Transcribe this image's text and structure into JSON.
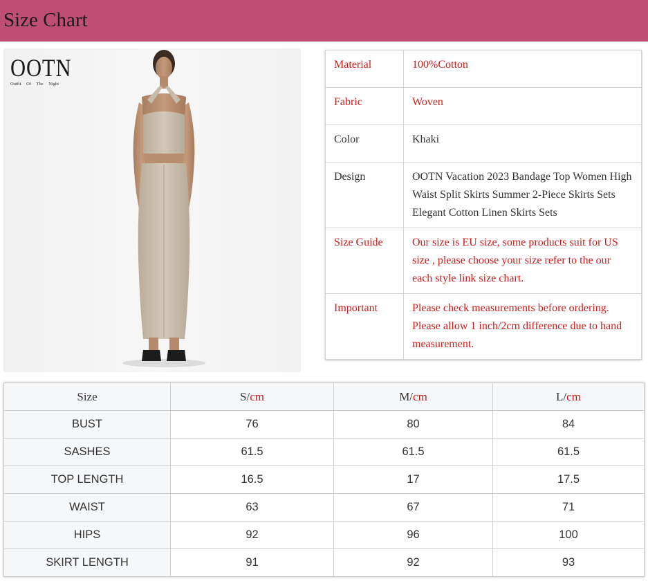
{
  "header": {
    "title": "Size Chart"
  },
  "logo": {
    "name": "OOTN",
    "tagline": "Outfit Of The Night"
  },
  "colors": {
    "header_bg": "#bf4e74",
    "accent_red": "#d11a1a"
  },
  "info": [
    {
      "key": "Material",
      "value": "100%Cotton",
      "style": "red"
    },
    {
      "key": "Fabric",
      "value": "Woven",
      "style": "red"
    },
    {
      "key": "Color",
      "value": "Khaki",
      "style": "dark"
    },
    {
      "key": "Design",
      "value": "OOTN Vacation 2023 Bandage Top Women High Waist Split Skirts Summer 2-Piece Skirts Sets Elegant Cotton Linen Skirts Sets",
      "style": "dark"
    },
    {
      "key": "Size Guide",
      "value": "Our size is EU size, some products suit for US size , please choose your size refer to the our each style link size chart.",
      "style": "red"
    },
    {
      "key": "Important",
      "value": "Please check measurements before ordering. Please allow 1 inch/2cm difference due to hand measurement.",
      "style": "red"
    }
  ],
  "size_table": {
    "headers": [
      {
        "size": "Size",
        "unit": ""
      },
      {
        "size": "S/",
        "unit": "cm"
      },
      {
        "size": "M/",
        "unit": "cm"
      },
      {
        "size": "L/",
        "unit": "cm"
      }
    ],
    "rows": [
      [
        "BUST",
        "76",
        "80",
        "84"
      ],
      [
        "SASHES",
        "61.5",
        "61.5",
        "61.5"
      ],
      [
        "TOP LENGTH",
        "16.5",
        "17",
        "17.5"
      ],
      [
        "WAIST",
        "63",
        "67",
        "71"
      ],
      [
        "HIPS",
        "92",
        "96",
        "100"
      ],
      [
        "SKIRT LENGTH",
        "91",
        "92",
        "93"
      ]
    ]
  }
}
